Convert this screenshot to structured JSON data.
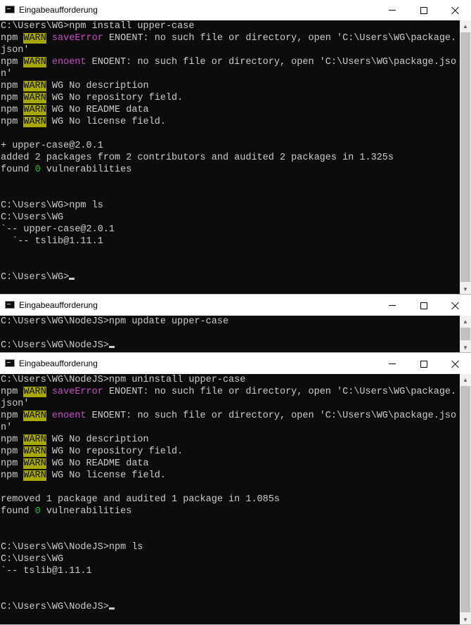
{
  "windows": [
    {
      "title": "Eingabeaufforderung",
      "lines": [
        [
          {
            "t": "C:\\Users\\WG>npm install upper-case"
          }
        ],
        [
          {
            "t": "npm "
          },
          {
            "t": "WARN",
            "s": "warn"
          },
          {
            "t": " "
          },
          {
            "t": "saveError",
            "s": "magenta"
          },
          {
            "t": " ENOENT: no such file or directory, open 'C:\\Users\\WG\\package."
          }
        ],
        [
          {
            "t": "json'"
          }
        ],
        [
          {
            "t": "npm "
          },
          {
            "t": "WARN",
            "s": "warn"
          },
          {
            "t": " "
          },
          {
            "t": "enoent",
            "s": "magenta"
          },
          {
            "t": " ENOENT: no such file or directory, open 'C:\\Users\\WG\\package.jso"
          }
        ],
        [
          {
            "t": "n'"
          }
        ],
        [
          {
            "t": "npm "
          },
          {
            "t": "WARN",
            "s": "warn"
          },
          {
            "t": " WG No description"
          }
        ],
        [
          {
            "t": "npm "
          },
          {
            "t": "WARN",
            "s": "warn"
          },
          {
            "t": " WG No repository field."
          }
        ],
        [
          {
            "t": "npm "
          },
          {
            "t": "WARN",
            "s": "warn"
          },
          {
            "t": " WG No README data"
          }
        ],
        [
          {
            "t": "npm "
          },
          {
            "t": "WARN",
            "s": "warn"
          },
          {
            "t": " WG No license field."
          }
        ],
        [],
        [
          {
            "t": "+ upper-case@2.0.1"
          }
        ],
        [
          {
            "t": "added 2 packages from 2 contributors and audited 2 packages in 1.325s"
          }
        ],
        [
          {
            "t": "found "
          },
          {
            "t": "0",
            "s": "green"
          },
          {
            "t": " vulnerabilities"
          }
        ],
        [],
        [],
        [
          {
            "t": "C:\\Users\\WG>npm ls"
          }
        ],
        [
          {
            "t": "C:\\Users\\WG"
          }
        ],
        [
          {
            "t": "`-- upper-case@2.0.1"
          }
        ],
        [
          {
            "t": "  `-- tslib@1.11.1"
          }
        ],
        [],
        [],
        [
          {
            "t": "C:\\Users\\WG>"
          },
          {
            "cursor": true
          }
        ]
      ]
    },
    {
      "title": "Eingabeaufforderung",
      "lines": [
        [
          {
            "t": "C:\\Users\\WG\\NodeJS>npm update upper-case"
          }
        ],
        [],
        [
          {
            "t": "C:\\Users\\WG\\NodeJS>"
          },
          {
            "cursor": true
          }
        ]
      ]
    },
    {
      "title": "Eingabeaufforderung",
      "lines": [
        [
          {
            "t": "C:\\Users\\WG\\NodeJS>npm uninstall upper-case"
          }
        ],
        [
          {
            "t": "npm "
          },
          {
            "t": "WARN",
            "s": "warn"
          },
          {
            "t": " "
          },
          {
            "t": "saveError",
            "s": "magenta"
          },
          {
            "t": " ENOENT: no such file or directory, open 'C:\\Users\\WG\\package."
          }
        ],
        [
          {
            "t": "json'"
          }
        ],
        [
          {
            "t": "npm "
          },
          {
            "t": "WARN",
            "s": "warn"
          },
          {
            "t": " "
          },
          {
            "t": "enoent",
            "s": "magenta"
          },
          {
            "t": " ENOENT: no such file or directory, open 'C:\\Users\\WG\\package.jso"
          }
        ],
        [
          {
            "t": "n'"
          }
        ],
        [
          {
            "t": "npm "
          },
          {
            "t": "WARN",
            "s": "warn"
          },
          {
            "t": " WG No description"
          }
        ],
        [
          {
            "t": "npm "
          },
          {
            "t": "WARN",
            "s": "warn"
          },
          {
            "t": " WG No repository field."
          }
        ],
        [
          {
            "t": "npm "
          },
          {
            "t": "WARN",
            "s": "warn"
          },
          {
            "t": " WG No README data"
          }
        ],
        [
          {
            "t": "npm "
          },
          {
            "t": "WARN",
            "s": "warn"
          },
          {
            "t": " WG No license field."
          }
        ],
        [],
        [
          {
            "t": "removed 1 package and audited 1 package in 1.085s"
          }
        ],
        [
          {
            "t": "found "
          },
          {
            "t": "0",
            "s": "green"
          },
          {
            "t": " vulnerabilities"
          }
        ],
        [],
        [],
        [
          {
            "t": "C:\\Users\\WG\\NodeJS>npm ls"
          }
        ],
        [
          {
            "t": "C:\\Users\\WG"
          }
        ],
        [
          {
            "t": "`-- tslib@1.11.1"
          }
        ],
        [],
        [],
        [
          {
            "t": "C:\\Users\\WG\\NodeJS>"
          },
          {
            "cursor": true
          }
        ]
      ]
    }
  ],
  "icons": {
    "app": "console-icon",
    "minimize": "minimize-icon",
    "maximize": "maximize-icon",
    "close": "close-icon"
  },
  "colors": {
    "console_bg": "#0c0c0c",
    "console_fg": "#cccccc",
    "warn_bg": "#a8a802",
    "magenta": "#c34fc3",
    "green": "#13c313"
  }
}
